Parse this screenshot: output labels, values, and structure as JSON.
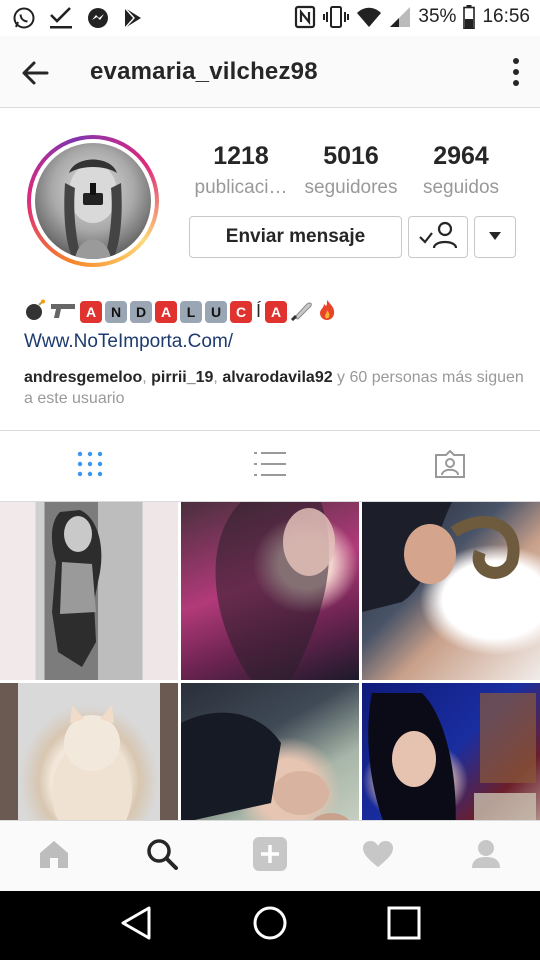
{
  "status_bar": {
    "battery_text": "35%",
    "time": "16:56",
    "icons_left": [
      "whatsapp-icon",
      "download-check-icon",
      "messenger-icon",
      "play-store-icon"
    ],
    "icons_right": [
      "nfc-icon",
      "vibrate-icon",
      "wifi-icon",
      "signal-icon",
      "battery-icon"
    ]
  },
  "app_bar": {
    "username": "evamaria_vilchez98",
    "back_icon": "back-arrow-icon",
    "menu_icon": "more-vertical-icon"
  },
  "profile": {
    "stats": [
      {
        "value": "1218",
        "label": "publicaci…"
      },
      {
        "value": "5016",
        "label": "seguidores"
      },
      {
        "value": "2964",
        "label": "seguidos"
      }
    ],
    "message_button": "Enviar mensaje",
    "bio_letters": [
      {
        "char": "A",
        "style": "red"
      },
      {
        "char": "N",
        "style": "gray"
      },
      {
        "char": "D",
        "style": "gray"
      },
      {
        "char": "A",
        "style": "red"
      },
      {
        "char": "L",
        "style": "gray"
      },
      {
        "char": "U",
        "style": "gray"
      },
      {
        "char": "C",
        "style": "red"
      },
      {
        "char": "Í",
        "style": "plain"
      },
      {
        "char": "A",
        "style": "red"
      }
    ],
    "bio_link": "Www.NoTeImporta.Com/",
    "followed_by": {
      "names": [
        "andresgemeloo",
        "pirrii_19",
        "alvarodavila92"
      ],
      "separator": ", ",
      "rest": " y 60 personas más siguen a este usuario"
    }
  },
  "tabs": [
    "grid-view-tab",
    "list-view-tab",
    "tagged-photos-tab"
  ],
  "posts": [
    "post-1",
    "post-2",
    "post-3",
    "post-4",
    "post-5",
    "post-6"
  ],
  "bottom_nav": [
    "home-icon",
    "search-icon",
    "add-post-icon",
    "activity-heart-icon",
    "profile-icon"
  ],
  "colors": {
    "link": "#1d3b6e",
    "muted": "#999999",
    "text": "#262626",
    "border": "#dbdbdb"
  }
}
